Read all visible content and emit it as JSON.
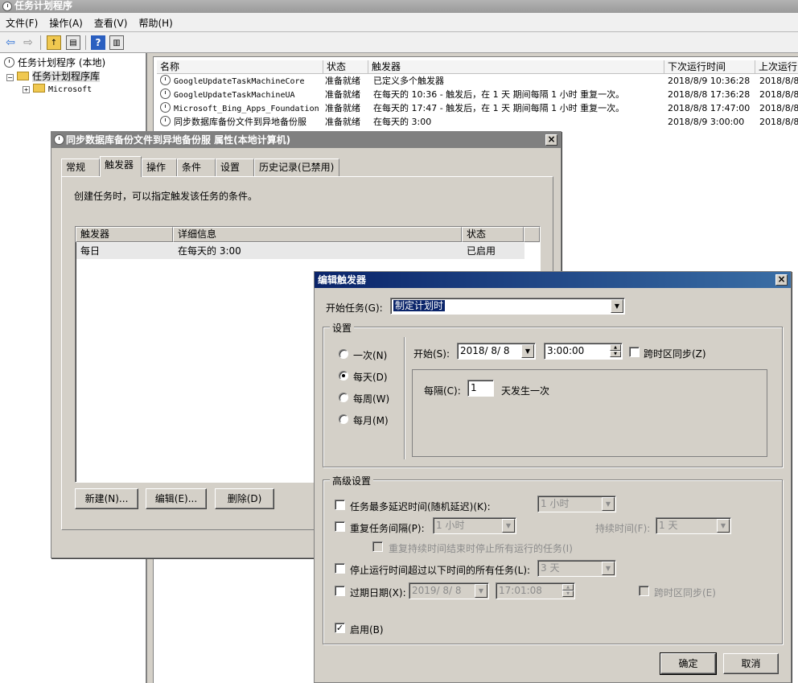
{
  "app": {
    "title": "任务计划程序"
  },
  "menu": [
    "文件(F)",
    "操作(A)",
    "查看(V)",
    "帮助(H)"
  ],
  "tree": {
    "root": "任务计划程序 (本地)",
    "library": "任务计划程序库",
    "microsoft": "Microsoft"
  },
  "tasklist": {
    "columns": [
      "名称",
      "状态",
      "触发器",
      "下次运行时间",
      "上次运行"
    ],
    "rows": [
      {
        "name": "GoogleUpdateTaskMachineCore",
        "status": "准备就绪",
        "trigger": "已定义多个触发器",
        "next": "2018/8/9 10:36:28",
        "last": "2018/8/8"
      },
      {
        "name": "GoogleUpdateTaskMachineUA",
        "status": "准备就绪",
        "trigger": "在每天的 10:36 - 触发后，在 1 天 期间每隔 1 小时 重复一次。",
        "next": "2018/8/8 17:36:28",
        "last": "2018/8/8"
      },
      {
        "name": "Microsoft_Bing_Apps_Foundation",
        "status": "准备就绪",
        "trigger": "在每天的 17:47 - 触发后，在 1 天 期间每隔 1 小时 重复一次。",
        "next": "2018/8/8 17:47:00",
        "last": "2018/8/8"
      },
      {
        "name": "同步数据库备份文件到异地备份服",
        "status": "准备就绪",
        "trigger": "在每天的 3:00",
        "next": "2018/8/9 3:00:00",
        "last": "2018/8/8"
      }
    ]
  },
  "props": {
    "title": "同步数据库备份文件到异地备份服 属性(本地计算机)",
    "tabs": [
      "常规",
      "触发器",
      "操作",
      "条件",
      "设置",
      "历史记录(已禁用)"
    ],
    "description": "创建任务时，可以指定触发该任务的条件。",
    "columns": [
      "触发器",
      "详细信息",
      "状态"
    ],
    "rows": [
      {
        "trigger": "每日",
        "detail": "在每天的 3:00",
        "status": "已启用"
      }
    ],
    "buttons": {
      "new": "新建(N)...",
      "edit": "编辑(E)...",
      "delete": "删除(D)"
    }
  },
  "edit_trigger": {
    "title": "编辑触发器",
    "begin_label": "开始任务(G):",
    "begin_value": "制定计划时",
    "settings_label": "设置",
    "schedule_options": [
      {
        "label": "一次(N)",
        "selected": false
      },
      {
        "label": "每天(D)",
        "selected": true
      },
      {
        "label": "每周(W)",
        "selected": false
      },
      {
        "label": "每月(M)",
        "selected": false
      }
    ],
    "start_label": "开始(S):",
    "start_date": "2018/ 8/ 8",
    "start_time": "3:00:00",
    "sync_tz_label": "跨时区同步(Z)",
    "recur_label": "每隔(C):",
    "recur_value": "1",
    "recur_suffix": "天发生一次",
    "advanced_label": "高级设置",
    "delay_label": "任务最多延迟时间(随机延迟)(K):",
    "delay_value": "1 小时",
    "repeat_label": "重复任务间隔(P):",
    "repeat_value": "1 小时",
    "duration_label": "持续时间(F):",
    "duration_value": "1 天",
    "stop_all_label": "重复持续时间结束时停止所有运行的任务(I)",
    "stop_longer_label": "停止运行时间超过以下时间的所有任务(L):",
    "stop_longer_value": "3 天",
    "expire_label": "过期日期(X):",
    "expire_date": "2019/ 8/ 8",
    "expire_time": "17:01:08",
    "expire_sync_label": "跨时区同步(E)",
    "enabled_label": "启用(B)",
    "enabled_checked": true,
    "ok": "确定",
    "cancel": "取消"
  },
  "colors": {
    "title_active": "#0a246a",
    "title_inactive": "#808080",
    "selection": "#0a246a"
  }
}
